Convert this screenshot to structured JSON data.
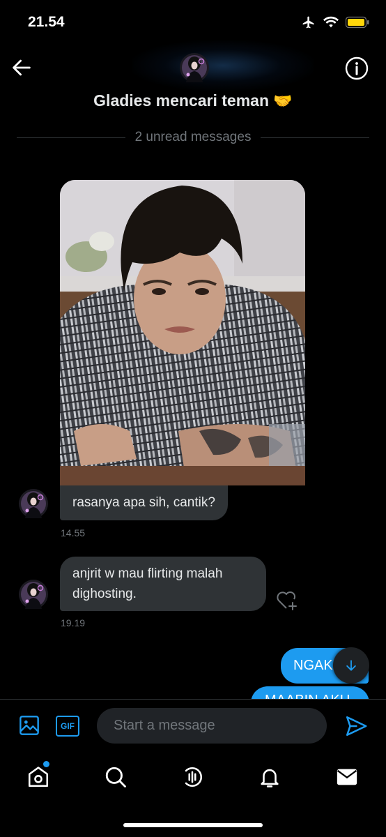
{
  "status_bar": {
    "time": "21.54"
  },
  "header": {
    "title": "Gladies mencari teman",
    "title_emoji": "🤝",
    "back_icon": "arrow-left-icon",
    "info_icon": "info-icon"
  },
  "conversation": {
    "unread_divider": "2 unread messages",
    "received": [
      {
        "text": "rasanya apa sih, cantik?",
        "timestamp": "14.55",
        "has_photo": true
      },
      {
        "text": "anjrit w mau flirting malah dighosting.",
        "timestamp": "19.19"
      }
    ],
    "sent": [
      {
        "text": "NGAK"
      },
      {
        "text": "MAABIN AKU"
      }
    ]
  },
  "composer": {
    "placeholder": "Start a message",
    "image_icon": "image-icon",
    "gif_label": "GIF",
    "send_icon": "send-icon"
  },
  "nav": {
    "items": [
      "home-icon",
      "search-icon",
      "spaces-icon",
      "notifications-icon",
      "messages-icon"
    ]
  },
  "colors": {
    "accent": "#1d9bf0",
    "bubble_received": "#2f3336",
    "background": "#000000",
    "muted_text": "#71767b"
  }
}
